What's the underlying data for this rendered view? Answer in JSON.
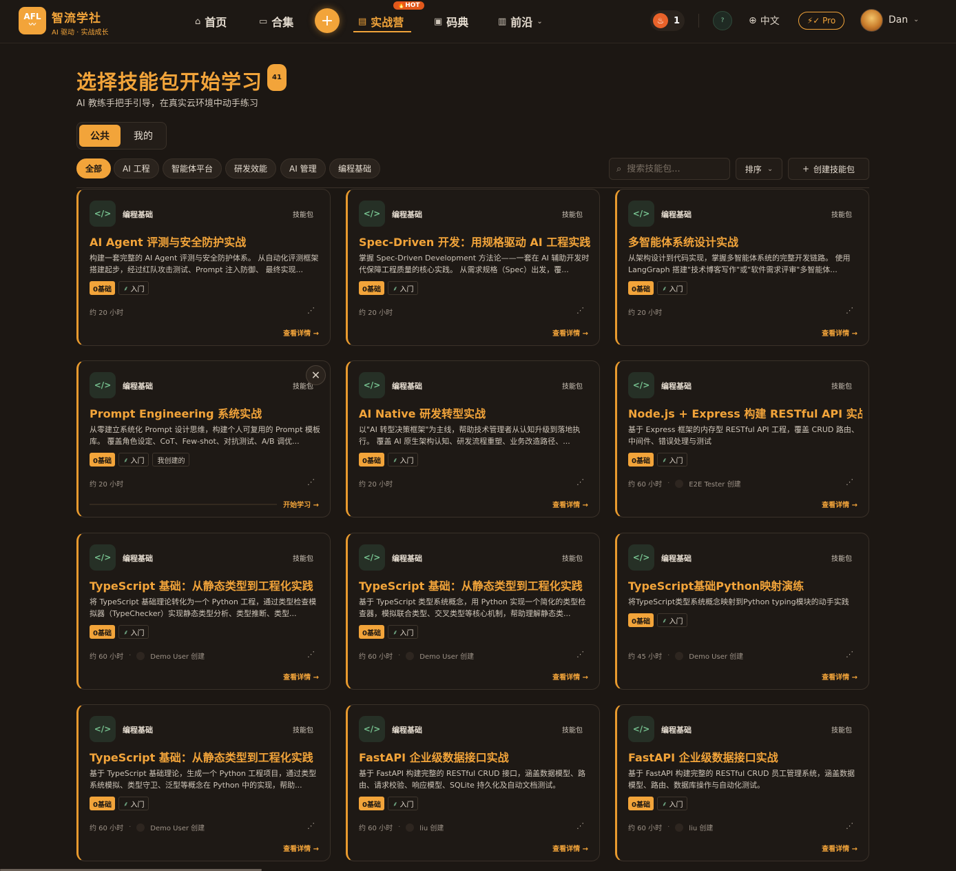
{
  "brand": {
    "logo_text": "AFL",
    "name": "智流学社",
    "tagline": "AI 驱动 · 实战成长"
  },
  "nav": {
    "items": [
      {
        "label": "首页",
        "icon": "home-icon"
      },
      {
        "label": "合集",
        "icon": "folder-icon"
      },
      {
        "label": "实战营",
        "icon": "terminal-icon",
        "active": true,
        "badge": "🔥HOT"
      },
      {
        "label": "码典",
        "icon": "image-icon"
      },
      {
        "label": "前沿",
        "icon": "document-icon"
      }
    ],
    "streak_count": "1",
    "help_label": "?",
    "language": "中文",
    "pro_label": "⚡✓ Pro",
    "username": "Dan"
  },
  "header": {
    "title": "选择技能包开始学习",
    "count": "41",
    "subtitle": "AI 教练手把手引导，在真实云环境中动手练习"
  },
  "scope_tabs": [
    {
      "label": "公共",
      "active": true
    },
    {
      "label": "我的",
      "active": false
    }
  ],
  "filters": [
    {
      "label": "全部",
      "active": true
    },
    {
      "label": "AI 工程"
    },
    {
      "label": "智能体平台"
    },
    {
      "label": "研发效能"
    },
    {
      "label": "AI 管理"
    },
    {
      "label": "编程基础"
    }
  ],
  "search": {
    "placeholder": "搜索技能包..."
  },
  "sort_label": "排序",
  "create_label": "创建技能包",
  "accent_color": "#f2a43a",
  "cards": [
    {
      "category": "编程基础",
      "type": "技能包",
      "title": "AI Agent 评测与安全防护实战",
      "desc": "构建一套完整的 AI Agent 评测与安全防护体系。 从自动化评测框架搭建起步，经过红队攻击测试、Prompt 注入防御、 最终实现...",
      "level": "0基础",
      "difficulty": "入门",
      "duration": "约 20 小时",
      "creator": "",
      "action": "查看详情 →"
    },
    {
      "category": "编程基础",
      "type": "技能包",
      "title": "Spec-Driven 开发：用规格驱动 AI 工程实践",
      "desc": "掌握 Spec-Driven Development 方法论——一套在 AI 辅助开发时代保障工程质量的核心实践。 从需求规格（Spec）出发，覆...",
      "level": "0基础",
      "difficulty": "入门",
      "duration": "约 20 小时",
      "creator": "",
      "action": "查看详情 →"
    },
    {
      "category": "编程基础",
      "type": "技能包",
      "title": "多智能体系统设计实战",
      "desc": "从架构设计到代码实现，掌握多智能体系统的完整开发链路。 使用 LangGraph 搭建\"技术博客写作\"或\"软件需求评审\"多智能体...",
      "level": "0基础",
      "difficulty": "入门",
      "duration": "约 20 小时",
      "creator": "",
      "action": "查看详情 →"
    },
    {
      "category": "编程基础",
      "type": "技能包",
      "title": "Prompt Engineering 系统实战",
      "desc": "从零建立系统化 Prompt 设计思维，构建个人可复用的 Prompt 模板库。 覆盖角色设定、CoT、Few-shot、对抗测试、A/B 调优...",
      "level": "0基础",
      "difficulty": "入门",
      "mine": "我创建的",
      "duration": "约 20 小时",
      "creator": "",
      "action": "开始学习 →",
      "progress": 0
    },
    {
      "category": "编程基础",
      "type": "技能包",
      "title": "AI Native 研发转型实战",
      "desc": "以\"AI 转型决策框架\"为主线，帮助技术管理者从认知升级到落地执行。 覆盖 AI 原生架构认知、研发流程重塑、业务改造路径、...",
      "level": "0基础",
      "difficulty": "入门",
      "duration": "约 20 小时",
      "creator": "",
      "action": "查看详情 →"
    },
    {
      "category": "编程基础",
      "type": "技能包",
      "title": "Node.js + Express 构建 RESTful API 实战",
      "desc": "基于 Express 框架的内存型 RESTful API 工程，覆盖 CRUD 路由、中间件、错误处理与测试",
      "level": "0基础",
      "difficulty": "入门",
      "duration": "约 60 小时",
      "creator": "E2E Tester 创建",
      "action": "查看详情 →"
    },
    {
      "category": "编程基础",
      "type": "技能包",
      "title": "TypeScript 基础：从静态类型到工程化实践",
      "desc": "将 TypeScript 基础理论转化为一个 Python 工程，通过类型检查模拟器（TypeChecker）实现静态类型分析、类型推断、类型...",
      "level": "0基础",
      "difficulty": "入门",
      "duration": "约 60 小时",
      "creator": "Demo User 创建",
      "action": "查看详情 →"
    },
    {
      "category": "编程基础",
      "type": "技能包",
      "title": "TypeScript 基础：从静态类型到工程化实践",
      "desc": "基于 TypeScript 类型系统概念，用 Python 实现一个简化的类型检查器，模拟联合类型、交叉类型等核心机制，帮助理解静态类...",
      "level": "0基础",
      "difficulty": "入门",
      "duration": "约 60 小时",
      "creator": "Demo User 创建",
      "action": "查看详情 →"
    },
    {
      "category": "编程基础",
      "type": "技能包",
      "title": "TypeScript基础Python映射演练",
      "desc": "将TypeScript类型系统概念映射到Python typing模块的动手实践",
      "level": "0基础",
      "difficulty": "入门",
      "duration": "约 45 小时",
      "creator": "Demo User 创建",
      "action": "查看详情 →",
      "one_line": true
    },
    {
      "category": "编程基础",
      "type": "技能包",
      "title": "TypeScript 基础：从静态类型到工程化实践",
      "desc": "基于 TypeScript 基础理论，生成一个 Python 工程项目，通过类型系统模拟、类型守卫、泛型等概念在 Python 中的实现，帮助...",
      "level": "0基础",
      "difficulty": "入门",
      "duration": "约 60 小时",
      "creator": "Demo User 创建",
      "action": "查看详情 →"
    },
    {
      "category": "编程基础",
      "type": "技能包",
      "title": "FastAPI 企业级数据接口实战",
      "desc": "基于 FastAPI 构建完整的 RESTful CRUD 接口，涵盖数据模型、路由、请求校验、响应模型、SQLite 持久化及自动文档测试。",
      "level": "0基础",
      "difficulty": "入门",
      "duration": "约 60 小时",
      "creator": "liu 创建",
      "action": "查看详情 →"
    },
    {
      "category": "编程基础",
      "type": "技能包",
      "title": "FastAPI 企业级数据接口实战",
      "desc": "基于 FastAPI 构建完整的 RESTful CRUD 员工管理系统，涵盖数据模型、路由、数据库操作与自动化测试。",
      "level": "0基础",
      "difficulty": "入门",
      "duration": "约 60 小时",
      "creator": "liu 创建",
      "action": "查看详情 →"
    }
  ]
}
